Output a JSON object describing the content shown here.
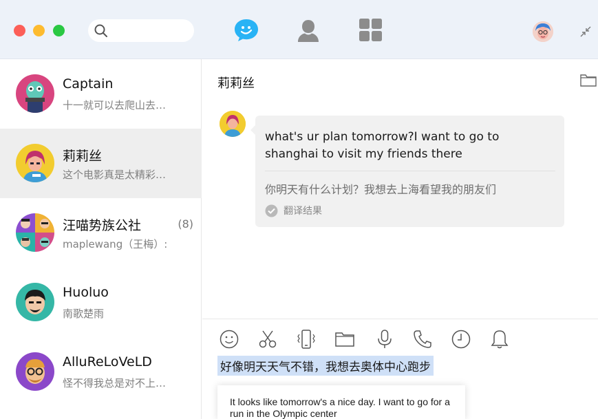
{
  "window": {
    "search": {
      "placeholder": ""
    },
    "nav": {
      "chat_icon": "chat-bubble-icon",
      "contacts_icon": "person-icon",
      "apps_icon": "apps-grid-icon"
    }
  },
  "conversations": [
    {
      "name": "Captain",
      "preview": "十一就可以去爬山去…",
      "count": "",
      "selected": false
    },
    {
      "name": "莉莉丝",
      "preview": "这个电影真是太精彩…",
      "count": "",
      "selected": true
    },
    {
      "name": "汪喵势族公社",
      "preview": "maplewang（王梅）:",
      "count": "(8)",
      "selected": false
    },
    {
      "name": "Huoluo",
      "preview": "南歌楚雨",
      "count": "",
      "selected": false
    },
    {
      "name": "AlluReLoVeLD",
      "preview": "怪不得我总是对不上…",
      "count": "",
      "selected": false
    }
  ],
  "chat": {
    "title": "莉莉丝",
    "message": {
      "text_en": "what's ur plan tomorrow?I want to go to shanghai to visit my friends there",
      "text_translated": "你明天有什么计划？我想去上海看望我的朋友们",
      "translation_badge": "翻译结果"
    }
  },
  "composer": {
    "tools": [
      "emoji-icon",
      "scissors-icon",
      "vibrate-icon",
      "folder-icon",
      "microphone-icon",
      "phone-icon",
      "clock-icon",
      "bell-icon"
    ],
    "draft_text": "好像明天天气不错，我想去奥体中心跑步",
    "translation_popup": "It looks like tomorrow's a nice day. I want to go for a run in the Olympic center"
  },
  "colors": {
    "titlebar_bg": "#edf2f9",
    "accent_blue": "#29b3f5",
    "selected_row": "#eeeeee",
    "bubble_bg": "#f1f1f1",
    "highlight": "#cfe0f7"
  }
}
